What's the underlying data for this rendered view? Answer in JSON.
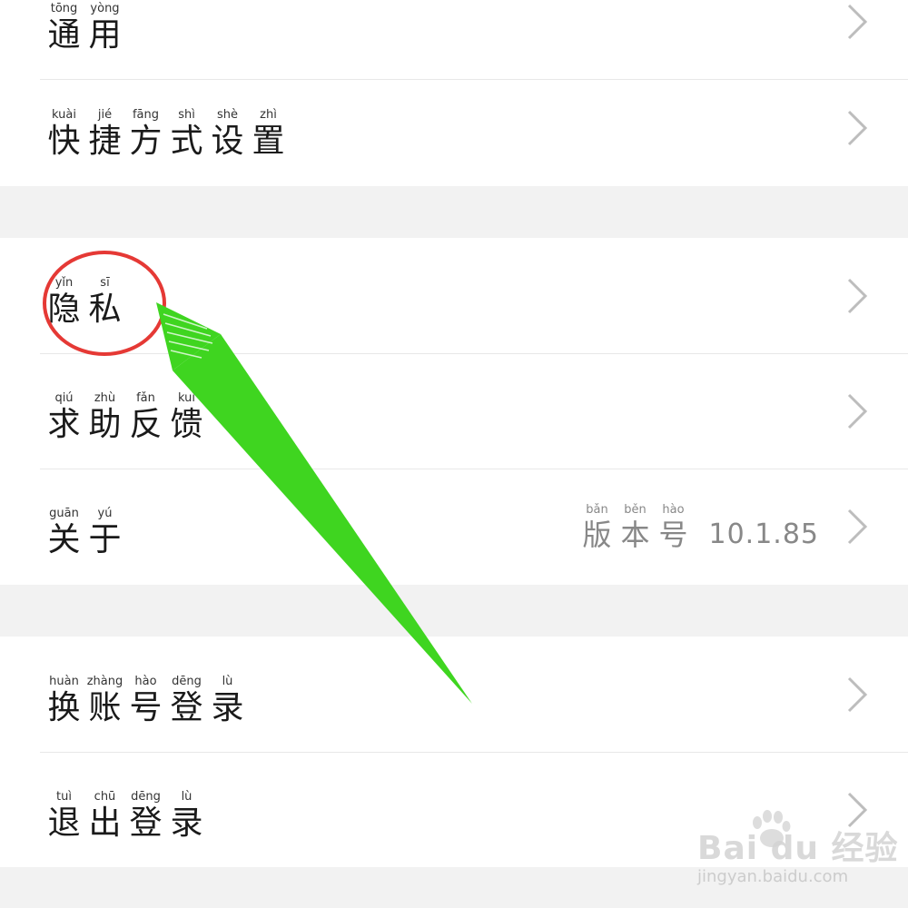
{
  "settings": {
    "group1": [
      {
        "pinyin": [
          "tōng",
          "yòng"
        ],
        "chars": [
          "通",
          "用"
        ]
      },
      {
        "pinyin": [
          "kuài",
          "jié",
          "fāng",
          "shì",
          "shè",
          "zhì"
        ],
        "chars": [
          "快",
          "捷",
          "方",
          "式",
          "设",
          "置"
        ]
      }
    ],
    "group2": [
      {
        "pinyin": [
          "yǐn",
          "sī"
        ],
        "chars": [
          "隐",
          "私"
        ]
      },
      {
        "pinyin": [
          "qiú",
          "zhù",
          "fǎn",
          "kuì"
        ],
        "chars": [
          "求",
          "助",
          "反",
          "馈"
        ]
      },
      {
        "pinyin": [
          "guān",
          "yú"
        ],
        "chars": [
          "关",
          "于"
        ]
      }
    ],
    "group3": [
      {
        "pinyin": [
          "huàn",
          "zhàng",
          "hào",
          "dēng",
          "lù"
        ],
        "chars": [
          "换",
          "账",
          "号",
          "登",
          "录"
        ]
      },
      {
        "pinyin": [
          "tuì",
          "chū",
          "dēng",
          "lù"
        ],
        "chars": [
          "退",
          "出",
          "登",
          "录"
        ]
      }
    ]
  },
  "about_meta": {
    "pinyin": [
      "bǎn",
      "běn",
      "hào"
    ],
    "chars": [
      "版",
      "本",
      "号"
    ],
    "version": "10.1.85"
  },
  "icons": {
    "row_chevron": "chevron-right-icon"
  },
  "annotation": {
    "circle_color": "#e53935",
    "arrow_color": "#3fd520"
  },
  "watermark": {
    "brand": "Bai du 经验",
    "url": "jingyan.baidu.com"
  }
}
